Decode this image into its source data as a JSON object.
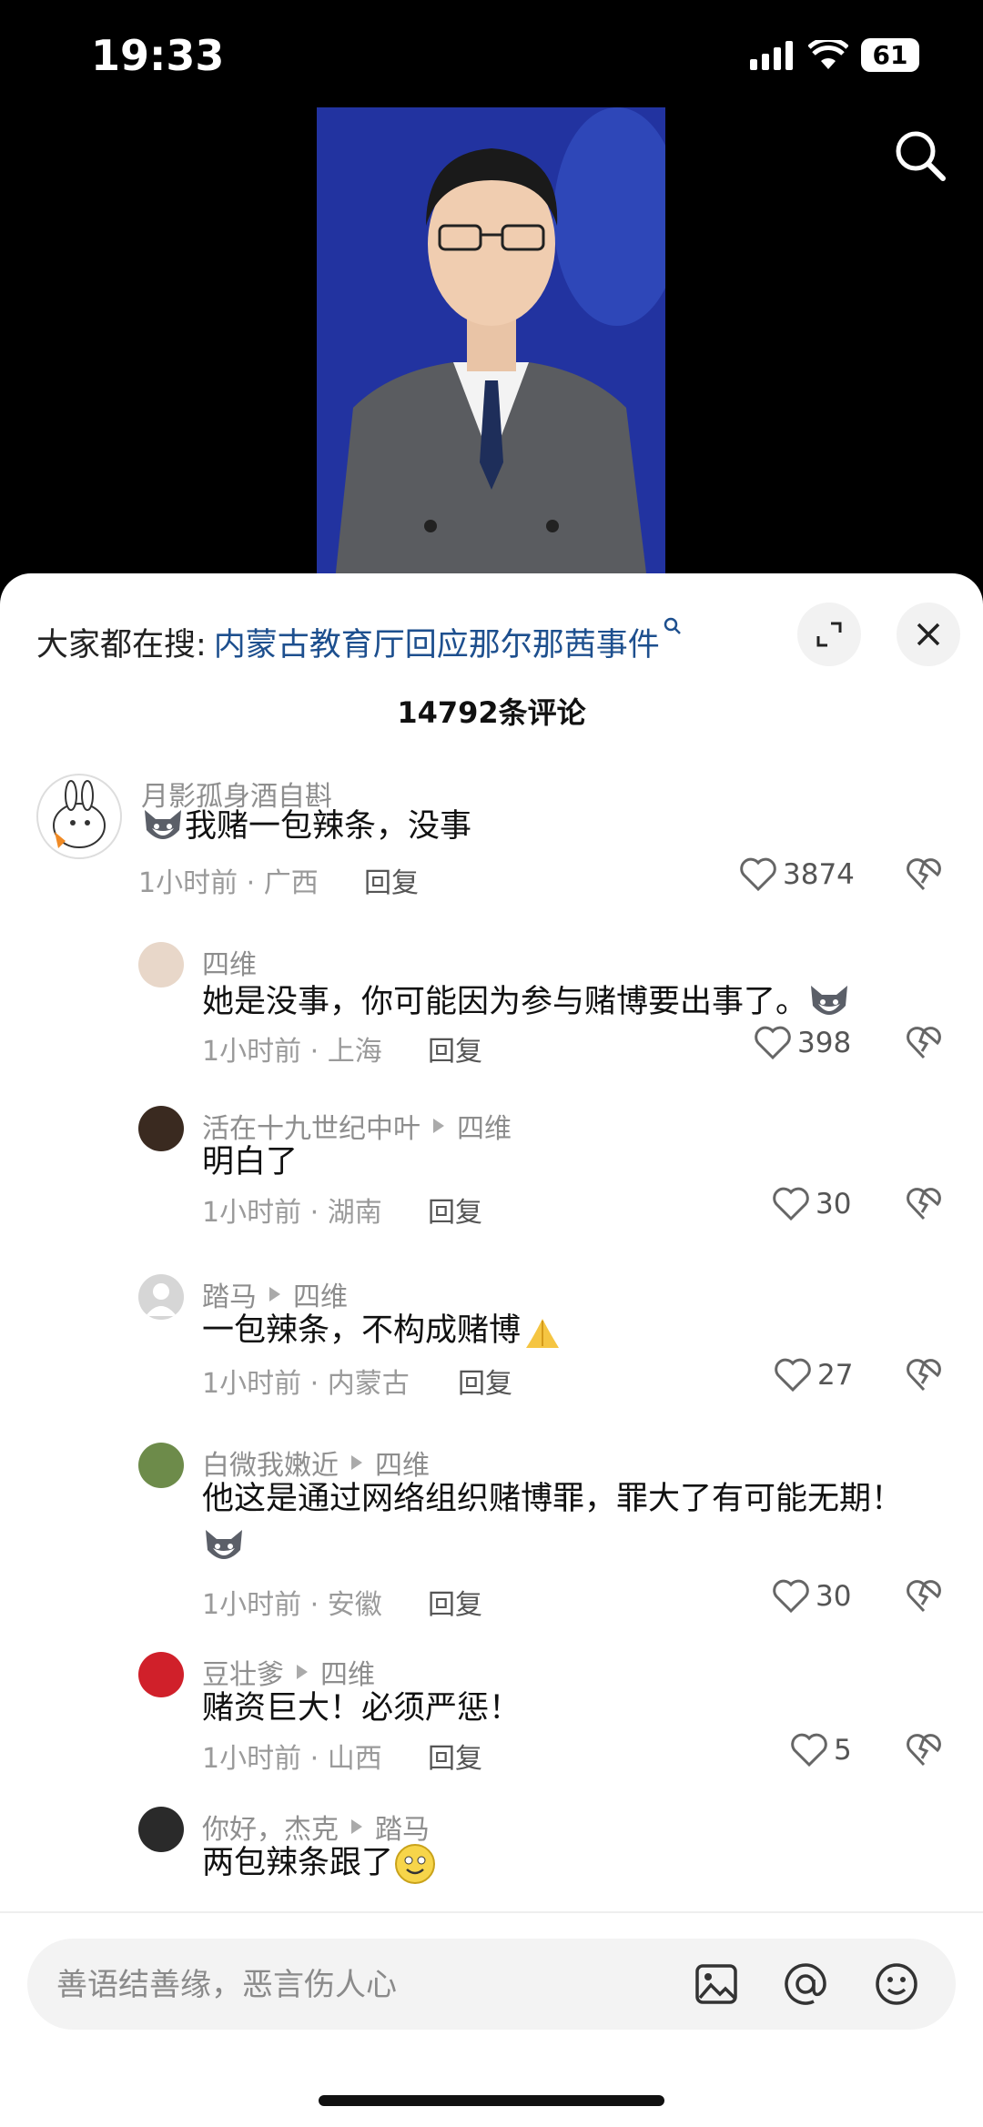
{
  "status_bar": {
    "time": "19:33",
    "battery": "61"
  },
  "hot_search": {
    "label": "大家都在搜:",
    "query": "内蒙古教育厅回应那尔那茜事件"
  },
  "comment_count": "14792条评论",
  "comments": [
    {
      "user": "月影孤身酒自斟",
      "text": "我赌一包辣条，没事",
      "meta": "1小时前 · 广西",
      "reply": "回复",
      "likes": "3874"
    },
    {
      "user": "四维",
      "text": "她是没事，你可能因为参与赌博要出事了。",
      "meta": "1小时前 · 上海",
      "reply": "回复",
      "likes": "398"
    },
    {
      "user": "活在十九世纪中叶",
      "reply_to": "四维",
      "text": "明白了",
      "meta": "1小时前 · 湖南",
      "reply": "回复",
      "likes": "30"
    },
    {
      "user": "踏马",
      "reply_to": "四维",
      "text": "一包辣条，不构成赌博",
      "meta": "1小时前 · 内蒙古",
      "reply": "回复",
      "likes": "27"
    },
    {
      "user": "白微我嫩近",
      "reply_to": "四维",
      "text": "他这是通过网络组织赌博罪，罪大了有可能无期！",
      "meta": "1小时前 · 安徽",
      "reply": "回复",
      "likes": "30"
    },
    {
      "user": "豆壮爹",
      "reply_to": "四维",
      "text": "赌资巨大！必须严惩！",
      "meta": "1小时前 · 山西",
      "reply": "回复",
      "likes": "5"
    },
    {
      "user": "你好，杰克",
      "reply_to": "踏马",
      "text": "两包辣条跟了"
    }
  ],
  "input": {
    "placeholder": "善语结善缘，恶言伤人心"
  },
  "colors": {
    "link": "#1d4f8e",
    "sheet_bg": "#ffffff",
    "bg": "#000000"
  }
}
